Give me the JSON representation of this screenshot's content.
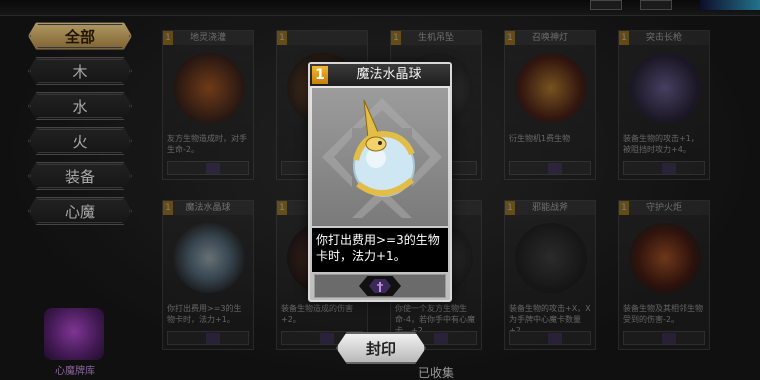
{
  "top_bar": {
    "title": ""
  },
  "sidebar": {
    "items": [
      {
        "label": "全部",
        "active": true
      },
      {
        "label": "木"
      },
      {
        "label": "水"
      },
      {
        "label": "火"
      },
      {
        "label": "装备"
      },
      {
        "label": "心魔"
      }
    ]
  },
  "grid_cards": [
    {
      "cost": "1",
      "name": "地灵浇灌",
      "desc": "友方生物造成时，对手生命-2。",
      "art_color": "#c05a1a"
    },
    {
      "cost": "1",
      "name": "",
      "desc": "",
      "art_color": "#8a4a22"
    },
    {
      "cost": "1",
      "name": "生机吊坠",
      "desc": "",
      "art_color": "#4a4a4a"
    },
    {
      "cost": "1",
      "name": "召唤神灯",
      "desc": "衍生物机1费生物",
      "art_color": "#c4541a"
    },
    {
      "cost": "1",
      "name": "突击长枪",
      "desc": "装备生物的攻击+1，被阻挡时攻力+4。",
      "art_color": "#5a4a8a"
    },
    {
      "cost": "1",
      "name": "魔法水晶球",
      "desc": "你打出费用>=3的生物卡时，法力+1。",
      "art_color": "#7aa6c4"
    },
    {
      "cost": "1",
      "name": "",
      "desc": "装备生物造成的伤害+2。",
      "art_color": "#5a3020"
    },
    {
      "cost": "1",
      "name": "",
      "desc": "你使一个友方生物生命-4，若你手中有心魔卡，+2。",
      "art_color": "#4a4a4a"
    },
    {
      "cost": "1",
      "name": "邪能战斧",
      "desc": "装备生物的攻击+X，X为手牌中心魔卡数量+2。",
      "art_color": "#3a3a3a"
    },
    {
      "cost": "1",
      "name": "守护火炬",
      "desc": "装备生物及其相邻生物受到的伤害-2。",
      "art_color": "#b8461a"
    }
  ],
  "chest": {
    "label": "心魔牌库"
  },
  "feature_card": {
    "cost": "1",
    "name": "魔法水晶球",
    "desc": "你打出费用>=3的生物卡时，法力+1。"
  },
  "seal_button": {
    "label": "封印"
  },
  "footer": {
    "collected_label": "已收集"
  }
}
